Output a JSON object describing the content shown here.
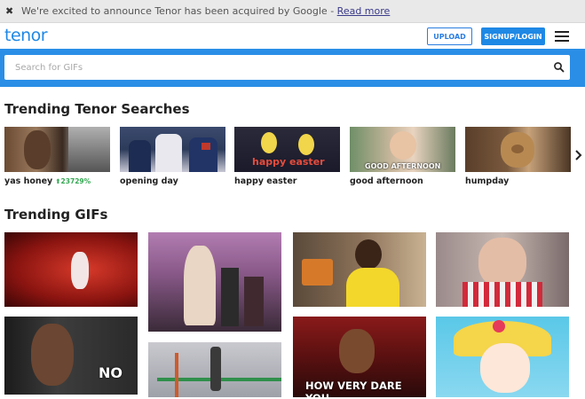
{
  "banner": {
    "close_icon": "close-icon",
    "message": "We're excited to announce Tenor has been acquired by Google - ",
    "link": "Read more"
  },
  "header": {
    "logo": "tenor",
    "upload_label": "UPLOAD",
    "signup_label": "SIGNUP/LOGIN",
    "menu_icon": "hamburger-menu-icon"
  },
  "search": {
    "placeholder": "Search for GIFs",
    "value": "",
    "icon": "search-icon"
  },
  "colors": {
    "brand_blue": "#1e88e5",
    "search_band": "#2a8ee6",
    "trend_green": "#34a853"
  },
  "trending_searches": {
    "title": "Trending Tenor Searches",
    "items": [
      {
        "label": "yas honey",
        "trend": "⬆23729%"
      },
      {
        "label": "opening day"
      },
      {
        "label": "happy easter",
        "overlay": "happy easter"
      },
      {
        "label": "good afternoon",
        "overlay": "GOOD AFTERNOON"
      },
      {
        "label": "humpday"
      }
    ],
    "next_icon": "chevron-right-icon"
  },
  "trending_gifs": {
    "title": "Trending GIFs",
    "overlays": {
      "no": "NO",
      "how_very_dare_you": "HOW VERY DARE YOU"
    }
  }
}
